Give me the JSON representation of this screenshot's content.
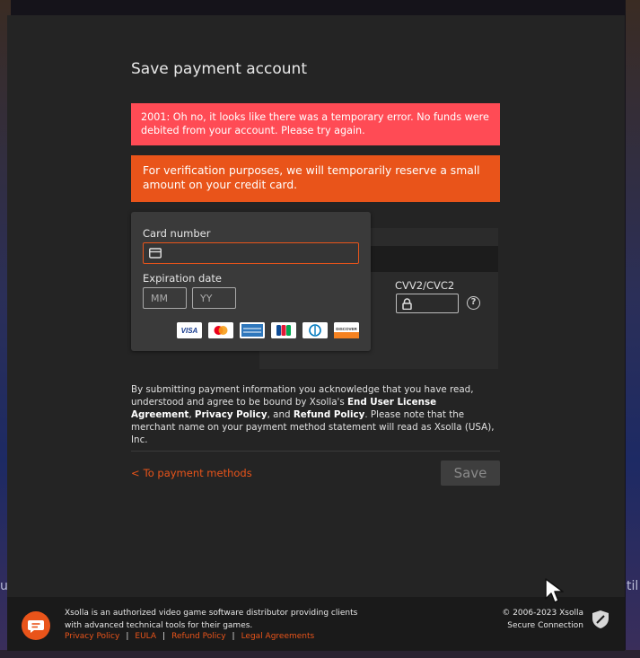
{
  "modal": {
    "title": "Save payment account",
    "error_message": "2001: Oh no, it looks like there was a temporary error. No funds were debited from your account. Please try again.",
    "verification_message": "For verification purposes, we will temporarily reserve a small amount on your credit card."
  },
  "card_form": {
    "card_number_label": "Card number",
    "card_number_value": "",
    "expiration_label": "Expiration date",
    "month_placeholder": "MM",
    "year_placeholder": "YY",
    "cvv_label": "CVV2/CVC2",
    "cvv_value": "",
    "help_symbol": "?",
    "card_logos": [
      "visa-logo",
      "mastercard-logo",
      "amex-logo",
      "jcb-logo",
      "diners-logo",
      "discover-logo"
    ]
  },
  "legal": {
    "part1": "By submitting payment information you acknowledge that you have read, understood and agree to be bound by Xsolla's ",
    "eula": "End User License Agreement",
    "part2": ", ",
    "privacy": "Privacy Policy",
    "part3": ", and ",
    "refund": "Refund Policy",
    "part4": ". Please note that the merchant name on your payment method statement will read as Xsolla (USA), Inc."
  },
  "actions": {
    "back_link": "To payment methods",
    "back_chevron": "<",
    "save_label": "Save"
  },
  "footer": {
    "text": "Xsolla is an authorized video game software distributor providing clients with advanced technical tools for their games.",
    "links": [
      "Privacy Policy",
      "EULA",
      "Refund Policy",
      "Legal Agreements"
    ],
    "separator": "|",
    "copyright": "© 2006-2023 Xsolla",
    "secure": "Secure Connection"
  },
  "background": {
    "left_glyph": "u",
    "right_glyph": "til"
  },
  "colors": {
    "accent": "#e9541a",
    "error": "#ff4b55",
    "modal_bg": "#242424"
  }
}
